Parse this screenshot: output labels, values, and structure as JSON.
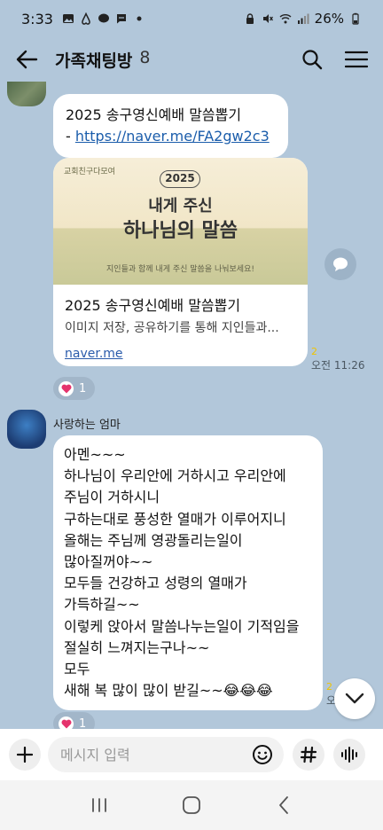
{
  "status_bar": {
    "time": "3:33",
    "battery": "26%"
  },
  "header": {
    "title": "가족채팅방",
    "member_count": "8"
  },
  "messages": {
    "msg1": {
      "line1": "2025 송구영신예배 말씀뽑기",
      "prefix": " - ",
      "link": "https://naver.me/FA2gw2c3"
    },
    "card": {
      "brand": "교회친구다모여",
      "year": "2025",
      "headline1": "내게 주신",
      "headline2": "하나님의 말씀",
      "subline": "지인들과 함께 내게 주신 말씀을 나눠보세요!",
      "title": "2025 송구영신예배 말씀뽑기",
      "desc": "이미지 저장, 공유하기를 통해 지인들과...",
      "url": "naver.me"
    },
    "meta1": {
      "unread": "2",
      "time": "오전 11:26"
    },
    "reaction1": {
      "count": "1"
    },
    "sender2": "사랑하는 엄마",
    "msg2_lines": [
      "아멘~~~",
      "하나님이 우리안에 거하시고 우리안에",
      "주님이 거하시니",
      "구하는대로 풍성한 열매가 이루어지니",
      "올해는 주님께 영광돌리는일이",
      "많아질꺼야~~",
      "모두들 건강하고 성령의 열매가",
      "가득하길~~",
      "이렇케 앉아서 말씀나누는일이 기적임을",
      "절실히 느껴지는구나~~",
      "모두",
      "새해 복 많이 많이 받길~~😂😂😂"
    ],
    "meta2": {
      "unread": "2",
      "time": "오"
    },
    "reaction2": {
      "count": "1"
    }
  },
  "input": {
    "placeholder": "메시지 입력"
  },
  "colors": {
    "chat_bg": "#b2c7da",
    "link": "#1b5dab",
    "unread": "#f0c400",
    "heart": "#e5336d"
  }
}
